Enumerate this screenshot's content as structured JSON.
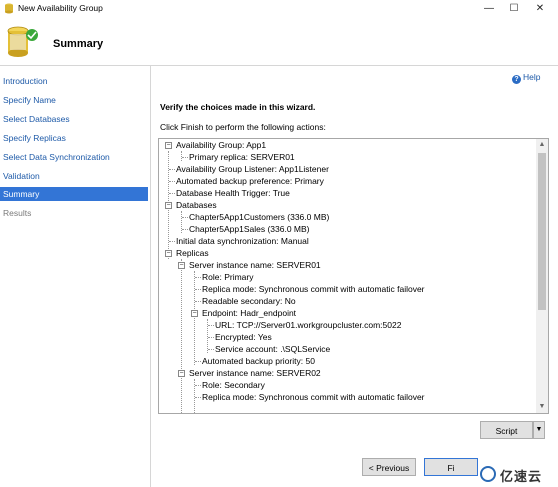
{
  "window": {
    "title": "New Availability Group"
  },
  "header": {
    "title": "Summary"
  },
  "sidebar": {
    "items": [
      {
        "label": "Introduction"
      },
      {
        "label": "Specify Name"
      },
      {
        "label": "Select Databases"
      },
      {
        "label": "Specify Replicas"
      },
      {
        "label": "Select Data Synchronization"
      },
      {
        "label": "Validation"
      },
      {
        "label": "Summary"
      },
      {
        "label": "Results"
      }
    ]
  },
  "help": {
    "label": "Help"
  },
  "main": {
    "heading": "Verify the choices made in this wizard.",
    "subtext": "Click Finish to perform the following actions:"
  },
  "tree": [
    "Availability Group: App1",
    "Primary replica: SERVER01",
    "Availability Group Listener: App1Listener",
    "Automated backup preference: Primary",
    "Database Health Trigger: True",
    "Databases",
    "Chapter5App1Customers (336.0 MB)",
    "Chapter5App1Sales (336.0 MB)",
    "Initial data synchronization: Manual",
    "Replicas",
    "Server instance name: SERVER01",
    "Role: Primary",
    "Replica mode: Synchronous commit with automatic failover",
    "Readable secondary: No",
    "Endpoint: Hadr_endpoint",
    "URL: TCP://Server01.workgroupcluster.com:5022",
    "Encrypted: Yes",
    "Service account: .\\SQLService",
    "Automated backup priority: 50",
    "Server instance name: SERVER02",
    "Role: Secondary",
    "Replica mode: Synchronous commit with automatic failover"
  ],
  "buttons": {
    "script": "Script",
    "previous": "< Previous",
    "finish": "Fi"
  },
  "watermark": {
    "text": "亿速云"
  },
  "colors": {
    "accent": "#3375d6",
    "link": "#1e5aa8"
  }
}
